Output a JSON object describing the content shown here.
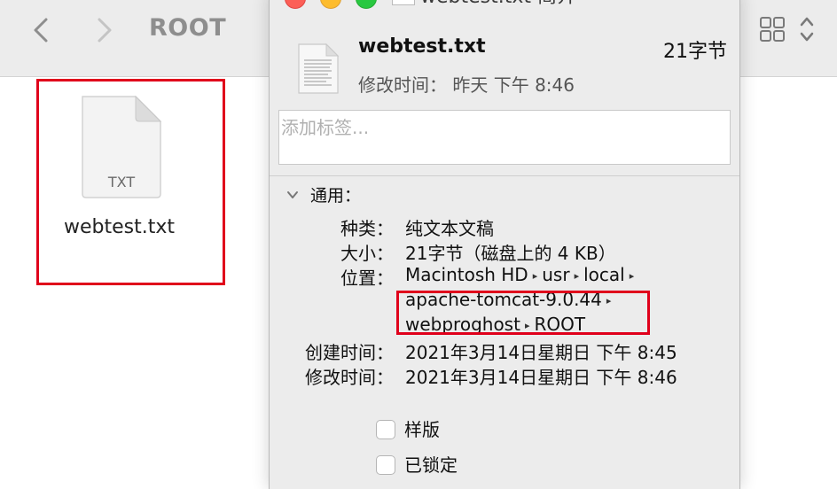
{
  "finder": {
    "title": "ROOT",
    "file_name": "webtest.txt",
    "file_icon_text": "TXT"
  },
  "info": {
    "window_title": "webtest.txt 简介",
    "file_name": "webtest.txt",
    "file_size": "21字节",
    "modified_header": "修改时间：  昨天 下午 8:46",
    "tags_placeholder": "添加标签...",
    "section_general": "通用：",
    "kind_label": "种类：",
    "kind_value": "纯文本文稿",
    "size_label": "大小：",
    "size_value": "21字节（磁盘上的 4 KB）",
    "where_label": "位置：",
    "where_parts": [
      "Macintosh HD",
      "usr",
      "local",
      "apache-tomcat-9.0.44",
      "webproghost",
      "ROOT"
    ],
    "created_label": "创建时间：",
    "created_value": "2021年3月14日星期日 下午 8:45",
    "modified_label": "修改时间：",
    "modified_value": "2021年3月14日星期日 下午 8:46",
    "stationery_label": "样版",
    "locked_label": "已锁定"
  },
  "colors": {
    "highlight_red": "#e0001b",
    "close": "#fc5f57",
    "minimize": "#fdbc2e",
    "zoom": "#28c840"
  }
}
